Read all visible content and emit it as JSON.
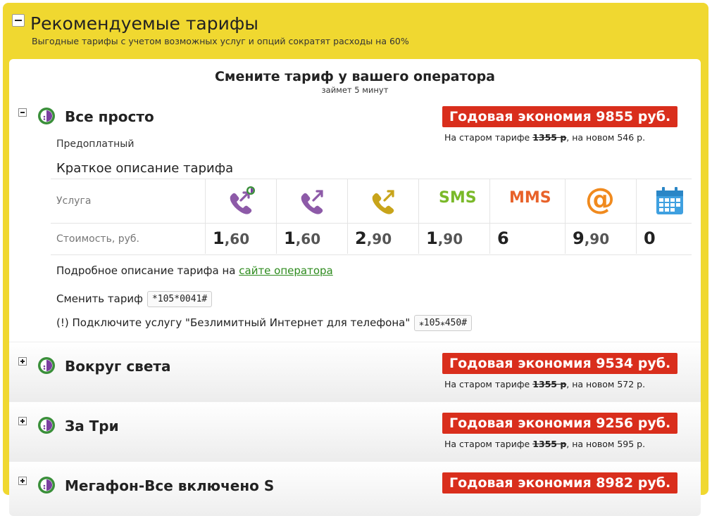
{
  "header": {
    "title": "Рекомендуемые тарифы",
    "subtitle": "Выгодные тарифы с учетом возможных услуг и опций сократят расходы на 60%"
  },
  "cta": {
    "title": "Смените тариф у вашего оператора",
    "subtitle": "займет 5 минут"
  },
  "accent_colors": {
    "panel_yellow": "#f0d830",
    "badge_red": "#d92e1c",
    "link_green": "#2e8b1e",
    "operator_purple": "#7a3fa0"
  },
  "expanded_tariff": {
    "name": "Все просто",
    "type": "Предоплатный",
    "saving": "Годовая экономия 9855 руб.",
    "price_prefix": "На старом тарифе",
    "old_price": "1355 р",
    "price_mid": ", на новом",
    "new_price": "546 р.",
    "short_desc_label": "Краткое описание тарифа",
    "services_label": "Услуга",
    "cost_label": "Стоимость, руб.",
    "services": [
      {
        "icon": "call-in-network-icon",
        "int": "1",
        "dec": ",60"
      },
      {
        "icon": "call-out-icon",
        "int": "1",
        "dec": ",60"
      },
      {
        "icon": "call-other-operator-icon",
        "int": "2",
        "dec": ",90"
      },
      {
        "icon": "sms-icon",
        "label": "SMS",
        "int": "1",
        "dec": ",90"
      },
      {
        "icon": "mms-icon",
        "label": "MMS",
        "int": "6",
        "dec": ""
      },
      {
        "icon": "internet-at-icon",
        "label": "@",
        "int": "9",
        "dec": ",90"
      },
      {
        "icon": "calendar-icon",
        "int": "0",
        "dec": ""
      }
    ],
    "detail_prefix": "Подробное описание тарифа на",
    "detail_link": "сайте оператора",
    "change_label": "Сменить тариф",
    "change_code": "*105*0041#",
    "note_text": "(!) Подключите услугу \"Безлимитный Интернет для телефона\"",
    "note_code": "⁎105⁎450#"
  },
  "collapsed_tariffs": [
    {
      "name": "Вокруг света",
      "saving": "Годовая экономия 9534 руб.",
      "price_prefix": "На старом тарифе",
      "old_price": "1355 р",
      "price_mid": ", на новом",
      "new_price": "572 р."
    },
    {
      "name": "За Три",
      "saving": "Годовая экономия 9256 руб.",
      "price_prefix": "На старом тарифе",
      "old_price": "1355 р",
      "price_mid": ", на новом",
      "new_price": "595 р."
    },
    {
      "name": "Мегафон-Все включено S",
      "saving": "Годовая экономия 8982 руб.",
      "price_prefix": "",
      "old_price": "",
      "price_mid": "",
      "new_price": ""
    }
  ]
}
